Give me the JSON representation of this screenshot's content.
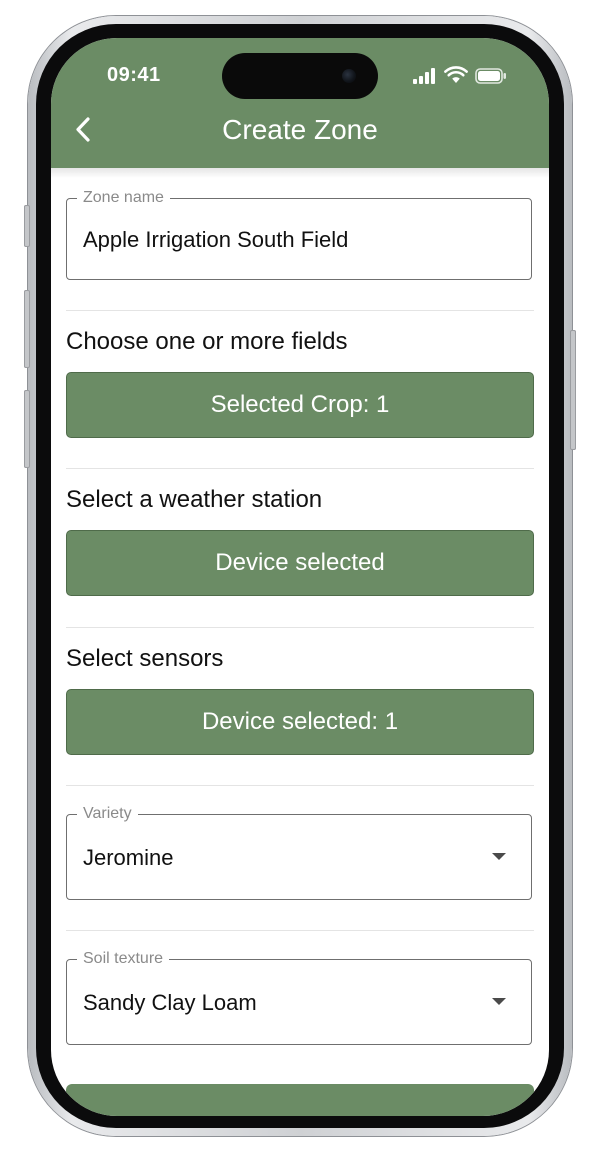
{
  "status_bar": {
    "time": "09:41",
    "signal_icon": "cellular-signal-icon",
    "wifi_icon": "wifi-icon",
    "battery_icon": "battery-icon"
  },
  "header": {
    "title": "Create Zone",
    "back_icon": "chevron-left-icon",
    "background_color": "#6b8c65"
  },
  "form": {
    "zone_name": {
      "label": "Zone name",
      "value": "Apple Irrigation South Field"
    },
    "fields": {
      "heading": "Choose one or more fields",
      "button_label": "Selected Crop: 1"
    },
    "weather_station": {
      "heading": "Select a weather station",
      "button_label": "Device selected"
    },
    "sensors": {
      "heading": "Select sensors",
      "button_label": "Device selected: 1"
    },
    "variety": {
      "label": "Variety",
      "value": "Jeromine"
    },
    "soil_texture": {
      "label": "Soil texture",
      "value": "Sandy Clay Loam"
    }
  },
  "colors": {
    "accent": "#6b8c65",
    "button_border": "#4f6b4a",
    "field_border": "#6f6f6f",
    "label_gray": "#8a8a8a"
  }
}
